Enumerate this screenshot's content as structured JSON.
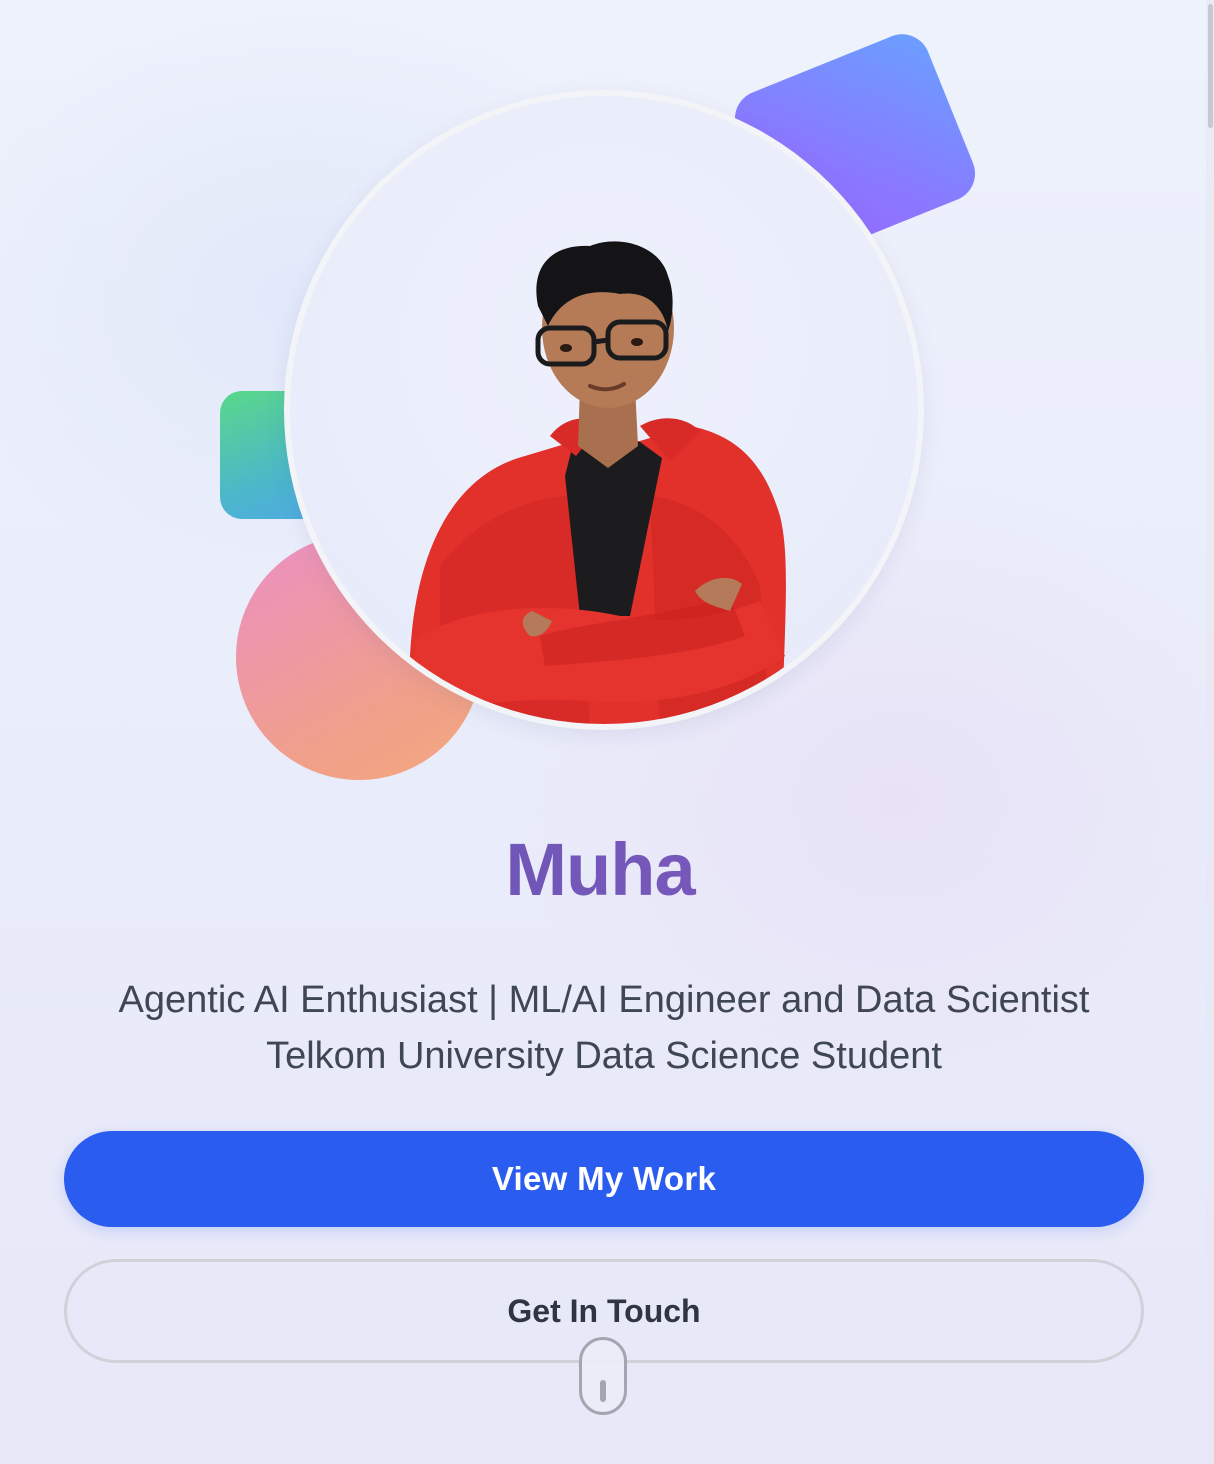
{
  "hero": {
    "name": "Muha",
    "tagline_line1": "Agentic AI Enthusiast | ML/AI Engineer and Data Scientist",
    "tagline_line2": "Telkom University Data Science Student",
    "avatar_alt": "Profile photo"
  },
  "actions": {
    "primary_label": "View My Work",
    "secondary_label": "Get In Touch"
  },
  "colors": {
    "primary": "#2b5cf0",
    "name_gradient_start": "#5d52b0",
    "name_gradient_end": "#8a5cc2",
    "text": "#3f4654"
  },
  "icons": {
    "scroll_indicator": "mouse-scroll-icon"
  }
}
